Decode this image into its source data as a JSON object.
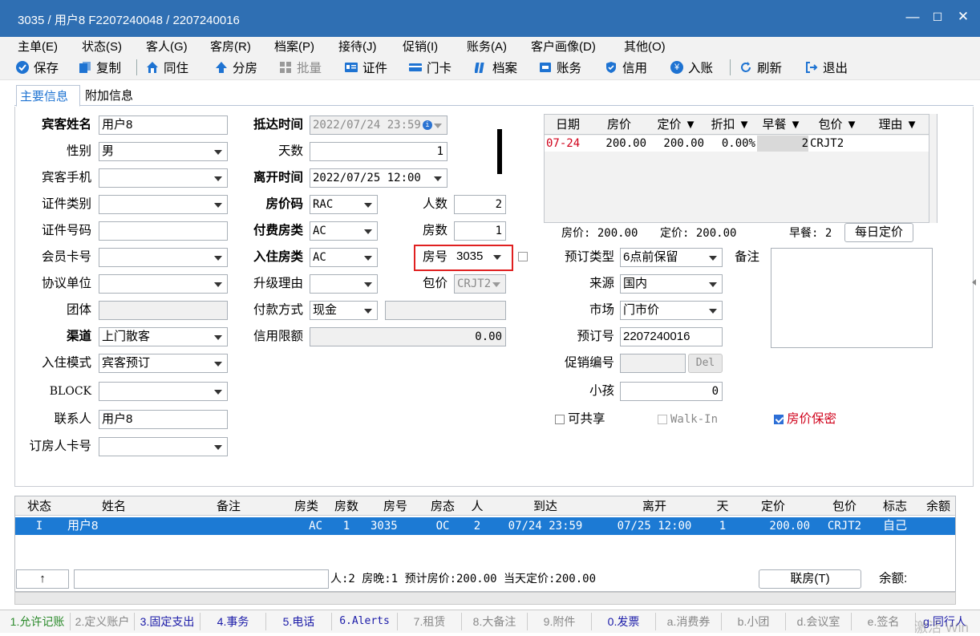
{
  "window": {
    "title": "3035 / 用户8 F2207240048 / 2207240016",
    "min": "—",
    "max": "☐",
    "close": "✕"
  },
  "menu": [
    "主单(E)",
    "状态(S)",
    "客人(G)",
    "客房(R)",
    "档案(P)",
    "接待(J)",
    "促销(I)",
    "账务(A)",
    "客户画像(D)",
    "其他(O)"
  ],
  "toolbar": {
    "save": "保存",
    "copy": "复制",
    "share": "同住",
    "split": "分房",
    "batch": "批量",
    "cert": "证件",
    "card": "门卡",
    "archive": "档案",
    "account": "账务",
    "credit": "信用",
    "post": "入账",
    "refresh": "刷新",
    "exit": "退出"
  },
  "tabs": {
    "main": "主要信息",
    "extra": "附加信息"
  },
  "form": {
    "guest_name": {
      "label": "宾客姓名",
      "value": "用户8"
    },
    "gender": {
      "label": "性别",
      "value": "男"
    },
    "phone": {
      "label": "宾客手机",
      "value": ""
    },
    "id_type": {
      "label": "证件类别",
      "value": ""
    },
    "id_no": {
      "label": "证件号码",
      "value": ""
    },
    "member": {
      "label": "会员卡号",
      "value": ""
    },
    "agreement": {
      "label": "协议单位",
      "value": ""
    },
    "group": {
      "label": "团体",
      "value": ""
    },
    "channel": {
      "label": "渠道",
      "value": "上门散客"
    },
    "checkin_mode": {
      "label": "入住模式",
      "value": "宾客预订"
    },
    "block": {
      "label": "BLOCK",
      "value": ""
    },
    "contact": {
      "label": "联系人",
      "value": "用户8"
    },
    "booker_card": {
      "label": "订房人卡号",
      "value": ""
    },
    "arrival": {
      "label": "抵达时间",
      "value": "2022/07/24 23:59"
    },
    "days": {
      "label": "天数",
      "value": "1"
    },
    "departure": {
      "label": "离开时间",
      "value": "2022/07/25 12:00"
    },
    "rate_code": {
      "label": "房价码",
      "value": "RAC"
    },
    "paid_room_type": {
      "label": "付费房类",
      "value": "AC"
    },
    "room_type": {
      "label": "入住房类",
      "value": "AC"
    },
    "upgrade_reason": {
      "label": "升级理由",
      "value": ""
    },
    "payment": {
      "label": "付款方式",
      "value": "现金"
    },
    "credit_limit": {
      "label": "信用限额",
      "value": "0.00"
    },
    "persons": {
      "label": "人数",
      "value": "2"
    },
    "rooms": {
      "label": "房数",
      "value": "1"
    },
    "room_no": {
      "label": "房号",
      "value": "3035"
    },
    "package": {
      "label": "包价",
      "value": "CRJT2"
    },
    "booking_type": {
      "label": "预订类型",
      "value": "6点前保留"
    },
    "remark": {
      "label": "备注",
      "value": ""
    },
    "source": {
      "label": "来源",
      "value": "国内"
    },
    "market": {
      "label": "市场",
      "value": "门市价"
    },
    "booking_no": {
      "label": "预订号",
      "value": "2207240016"
    },
    "promo": {
      "label": "促销编号",
      "value": "",
      "del": "Del"
    },
    "children": {
      "label": "小孩",
      "value": "0"
    },
    "shareable": "可共享",
    "walkin": "Walk-In",
    "rate_secret": "房价保密"
  },
  "rate_grid": {
    "headers": [
      "日期",
      "房价",
      "定价 ▼",
      "折扣 ▼",
      "早餐 ▼",
      "包价 ▼",
      "理由 ▼"
    ],
    "rows": [
      {
        "date": "07-24",
        "rate": "200.00",
        "price": "200.00",
        "discount": "0.00%",
        "breakfast": "2",
        "package": "CRJT2",
        "reason": ""
      }
    ],
    "summary": {
      "rate": "房价: 200.00",
      "price": "定价: 200.00",
      "breakfast": "早餐: 2",
      "daily_btn": "每日定价"
    }
  },
  "room_grid": {
    "headers": [
      "状态",
      "姓名",
      "备注",
      "房类",
      "房数",
      "房号",
      "房态",
      "人",
      "到达",
      "离开",
      "天",
      "定价",
      "包价",
      "标志",
      "余额"
    ],
    "rows": [
      {
        "status": "I",
        "name": "用户8",
        "note": "",
        "type": "AC",
        "count": "1",
        "room": "3035",
        "state": "OC",
        "persons": "2",
        "arrive": "07/24 23:59",
        "depart": "07/25 12:00",
        "days": "1",
        "price": "200.00",
        "package": "CRJT2",
        "flag": "自己",
        "balance": ""
      }
    ],
    "footer": {
      "arrow": "↑",
      "summary": "人:2  房晚:1  预计房价:200.00  当天定价:200.00",
      "link_btn": "联房(T)",
      "balance": "余额:"
    }
  },
  "fkeys": [
    "1.允许记账",
    "2.定义账户",
    "3.固定支出",
    "4.事务",
    "5.电话",
    "6.Alerts",
    "7.租赁",
    "8.大备注",
    "9.附件",
    "0.发票",
    "a.消费券",
    "b.小团",
    "d.会议室",
    "e.签名",
    "g.同行人"
  ],
  "watermark": "激活 Win",
  "colors": {
    "title_bg": "#2f6fb3",
    "selection": "#1c7ad4",
    "highlight_border": "#e02020",
    "accent_red": "#d0021b"
  }
}
